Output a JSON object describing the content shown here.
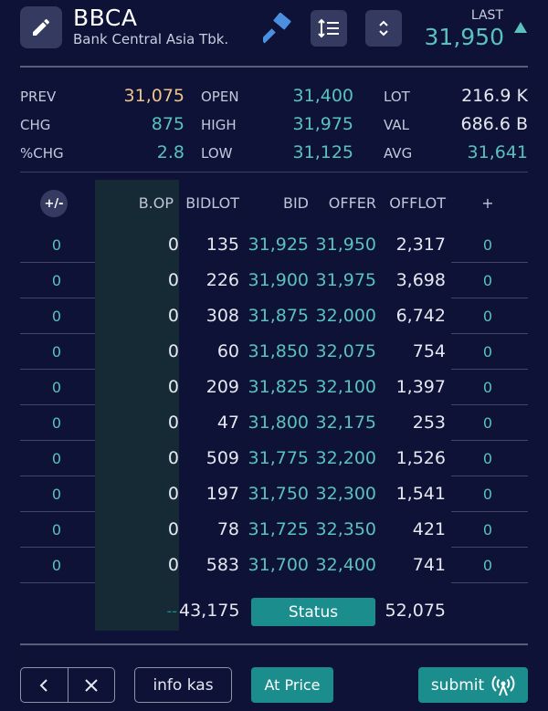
{
  "header": {
    "ticker": "BBCA",
    "company": "Bank Central Asia Tbk.",
    "last_label": "LAST",
    "last_value": "31,950",
    "trend": "up"
  },
  "summary": {
    "prev_label": "PREV",
    "prev_value": "31,075",
    "chg_label": "CHG",
    "chg_value": "875",
    "pchg_label": "%CHG",
    "pchg_value": "2.8",
    "open_label": "OPEN",
    "open_value": "31,400",
    "high_label": "HIGH",
    "high_value": "31,975",
    "low_label": "LOW",
    "low_value": "31,125",
    "lot_label": "LOT",
    "lot_value": "216.9 K",
    "val_label": "VAL",
    "val_value": "686.6 B",
    "avg_label": "AVG",
    "avg_value": "31,641"
  },
  "orderbook": {
    "pct_toggle": "+/-",
    "headers": {
      "bop": "B.OP",
      "bidlot": "BIDLOT",
      "bid": "BID",
      "offer": "OFFER",
      "offlot": "OFFLOT",
      "plus": "+"
    },
    "rows": [
      {
        "left": "0",
        "bop": "0",
        "bidlot": "135",
        "bid": "31,925",
        "offer": "31,950",
        "offlot": "2,317",
        "right": "0"
      },
      {
        "left": "0",
        "bop": "0",
        "bidlot": "226",
        "bid": "31,900",
        "offer": "31,975",
        "offlot": "3,698",
        "right": "0"
      },
      {
        "left": "0",
        "bop": "0",
        "bidlot": "308",
        "bid": "31,875",
        "offer": "32,000",
        "offlot": "6,742",
        "right": "0"
      },
      {
        "left": "0",
        "bop": "0",
        "bidlot": "60",
        "bid": "31,850",
        "offer": "32,075",
        "offlot": "754",
        "right": "0"
      },
      {
        "left": "0",
        "bop": "0",
        "bidlot": "209",
        "bid": "31,825",
        "offer": "32,100",
        "offlot": "1,397",
        "right": "0"
      },
      {
        "left": "0",
        "bop": "0",
        "bidlot": "47",
        "bid": "31,800",
        "offer": "32,175",
        "offlot": "253",
        "right": "0"
      },
      {
        "left": "0",
        "bop": "0",
        "bidlot": "509",
        "bid": "31,775",
        "offer": "32,200",
        "offlot": "1,526",
        "right": "0"
      },
      {
        "left": "0",
        "bop": "0",
        "bidlot": "197",
        "bid": "31,750",
        "offer": "32,300",
        "offlot": "1,541",
        "right": "0"
      },
      {
        "left": "0",
        "bop": "0",
        "bidlot": "78",
        "bid": "31,725",
        "offer": "32,350",
        "offlot": "421",
        "right": "0"
      },
      {
        "left": "0",
        "bop": "0",
        "bidlot": "583",
        "bid": "31,700",
        "offer": "32,400",
        "offlot": "741",
        "right": "0"
      }
    ],
    "totals": {
      "bop": "--",
      "bid_total": "43,175",
      "status_label": "Status",
      "offer_total": "52,075"
    }
  },
  "footer": {
    "info_label": "info kas",
    "atprice_label": "At Price",
    "submit_label": "submit"
  },
  "colors": {
    "background": "#0d1236",
    "accent": "#1b8d8c",
    "teal_text": "#5bc1be",
    "prev_text": "#f1c38a"
  }
}
